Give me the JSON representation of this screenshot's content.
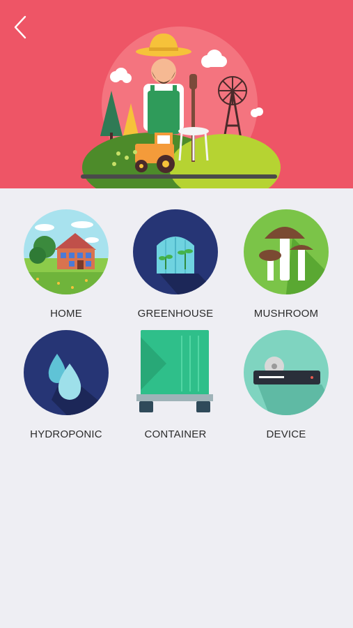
{
  "header": {
    "back_label": "back",
    "background_color": "#ee5566",
    "hero_illustration": "farmer-illustration"
  },
  "categories": [
    {
      "label": "HOME",
      "icon": "house-icon"
    },
    {
      "label": "GREENHOUSE",
      "icon": "greenhouse-icon"
    },
    {
      "label": "MUSHROOM",
      "icon": "mushroom-icon"
    },
    {
      "label": "HYDROPONIC",
      "icon": "water-drops-icon"
    },
    {
      "label": "CONTAINER",
      "icon": "shipping-container-icon"
    },
    {
      "label": "DEVICE",
      "icon": "device-icon"
    }
  ]
}
